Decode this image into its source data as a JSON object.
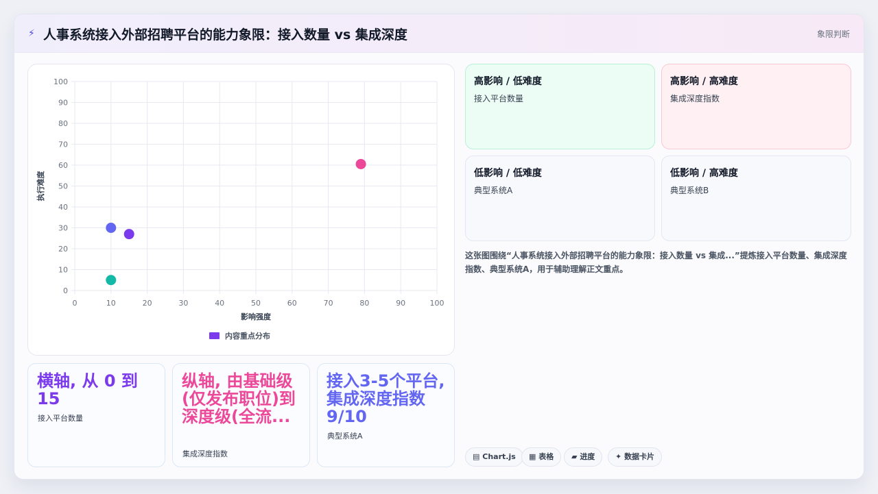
{
  "header": {
    "icon": "⚡",
    "title": "人事系统接入外部招聘平台的能力象限：接入数量 vs 集成深度",
    "tag": "象限判断"
  },
  "chart_data": {
    "type": "scatter",
    "xlabel": "影响强度",
    "ylabel": "执行难度",
    "xlim": [
      0,
      100
    ],
    "ylim": [
      0,
      100
    ],
    "xticks": [
      0,
      10,
      20,
      30,
      40,
      50,
      60,
      70,
      80,
      90,
      100
    ],
    "yticks": [
      0,
      10,
      20,
      30,
      40,
      50,
      60,
      70,
      80,
      90,
      100
    ],
    "grid": true,
    "legend": "bottom",
    "series": [
      {
        "name": "内容重点分布",
        "color": "#7c3aed",
        "points": [
          {
            "x": 10,
            "y": 30,
            "color": "#6366f1"
          },
          {
            "x": 15,
            "y": 27,
            "color": "#7c3aed"
          },
          {
            "x": 10,
            "y": 5,
            "color": "#14b8a6"
          },
          {
            "x": 79,
            "y": 60.5,
            "color": "#ec4899"
          }
        ]
      }
    ]
  },
  "stats": [
    {
      "value": "横轴, 从 0 到 15",
      "label": "接入平台数量",
      "color": "#7c3aed"
    },
    {
      "value": "纵轴, 由基础级(仅发布职位)到深度级(全流...",
      "label": "集成深度指数",
      "color": "#ec4899"
    },
    {
      "value": "接入3-5个平台, 集成深度指数 9/10",
      "label": "典型系统A",
      "color": "#6366f1"
    }
  ],
  "quadrants": [
    {
      "title": "高影响 / 低难度",
      "item": "接入平台数量",
      "bg": "#ecfdf5",
      "border": "#bbf0d6"
    },
    {
      "title": "高影响 / 高难度",
      "item": "集成深度指数",
      "bg": "#fff1f3",
      "border": "#f7c9d3"
    },
    {
      "title": "低影响 / 低难度",
      "item": "典型系统A",
      "bg": "#f8f9fc",
      "border": "#e3e7f0"
    },
    {
      "title": "低影响 / 高难度",
      "item": "典型系统B",
      "bg": "#f8f9fc",
      "border": "#e3e7f0"
    }
  ],
  "description": "这张图围绕“人事系统接入外部招聘平台的能力象限：接入数量 vs 集成...”提炼接入平台数量、集成深度指数、典型系统A，用于辅助理解正文重点。",
  "chips": [
    {
      "icon": "chart-icon",
      "glyph": "▤",
      "label": "Chart.js"
    },
    {
      "icon": "table-icon",
      "glyph": "▦",
      "label": "表格"
    },
    {
      "icon": "progress-icon",
      "glyph": "▰",
      "label": "进度"
    },
    {
      "icon": "card-icon",
      "glyph": "✦",
      "label": "数据卡片"
    }
  ]
}
